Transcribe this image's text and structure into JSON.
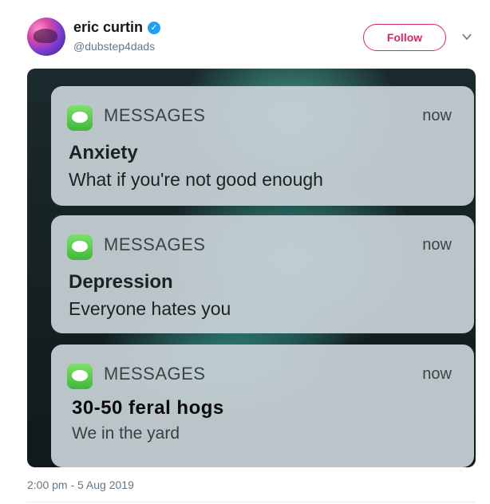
{
  "tweet": {
    "display_name": "eric curtin",
    "verified_glyph": "✓",
    "handle": "@dubstep4dads",
    "follow_label": "Follow",
    "timestamp": "2:00 pm - 5 Aug 2019"
  },
  "notifications": [
    {
      "app": "MESSAGES",
      "time": "now",
      "title": "Anxiety",
      "body": "What if you're not good enough"
    },
    {
      "app": "MESSAGES",
      "time": "now",
      "title": "Depression",
      "body": "Everyone hates you"
    },
    {
      "app": "MESSAGES",
      "time": "now",
      "title": "30-50 feral hogs",
      "body": "We in the yard"
    }
  ],
  "colors": {
    "follow_accent": "#e0245e",
    "verified_blue": "#1da1f2",
    "messages_green": "#3fb83a"
  },
  "icons": [
    "verified-badge-icon",
    "chevron-down-icon",
    "messages-app-icon"
  ]
}
